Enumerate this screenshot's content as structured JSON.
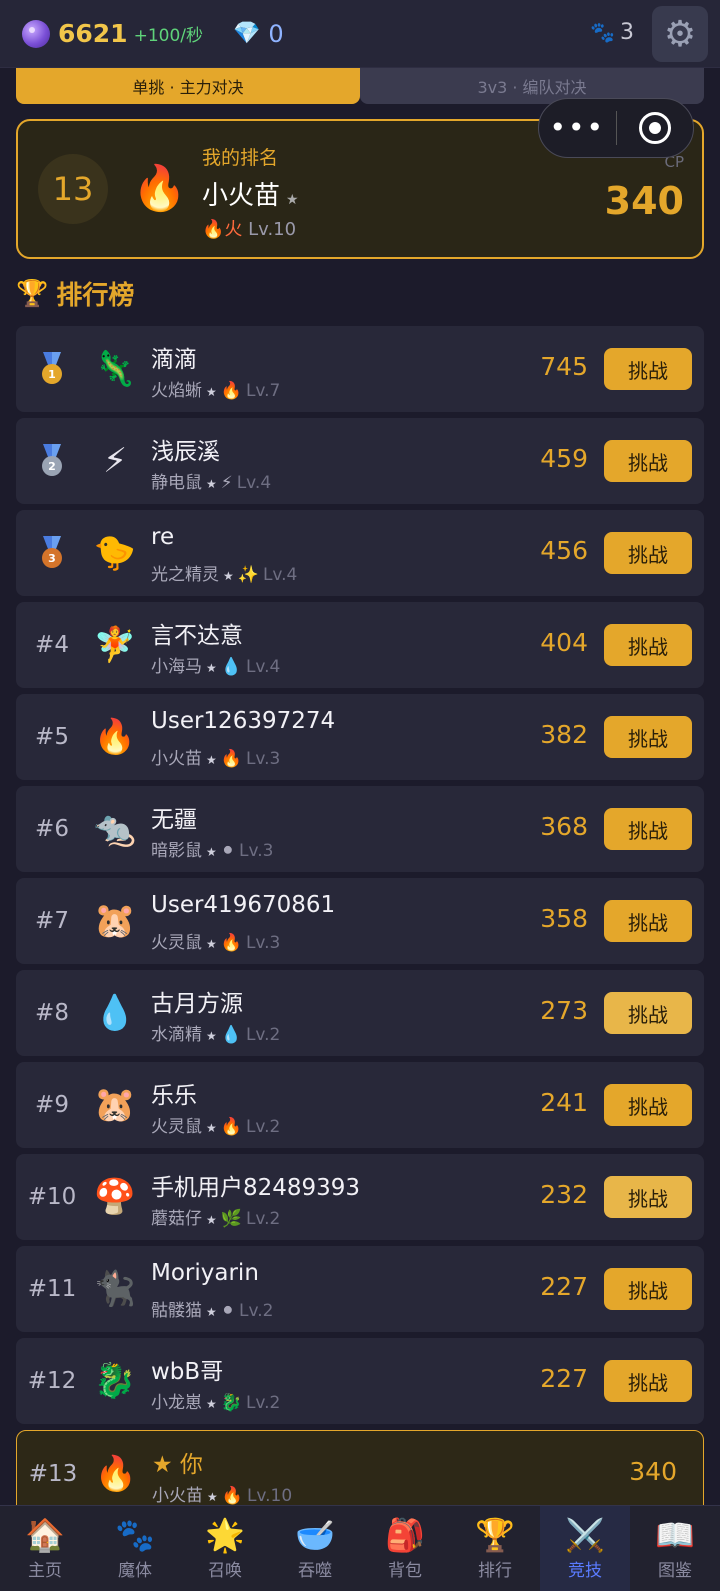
{
  "topbar": {
    "orb_icon": "purple-orb-icon",
    "coins": "6621",
    "rate": "+100/秒",
    "gems": "0",
    "paw_count": "3"
  },
  "tabs": [
    {
      "label": "单挑 · 主力对决",
      "active": true
    },
    {
      "label": "3v3 · 编队对决",
      "active": false
    }
  ],
  "capsule": {
    "more": "•••"
  },
  "my_rank": {
    "label": "我的排名",
    "rank": "13",
    "avatar": "🔥",
    "name": "小火苗",
    "star": "★",
    "element_icon": "🔥",
    "element": "火",
    "level": "Lv.10",
    "cp_label": "CP",
    "cp": "340"
  },
  "leaderboard": {
    "title": "排行榜",
    "challenge_label": "挑战",
    "rows": [
      {
        "rank": "1",
        "avatar": "🦎",
        "name": "滴滴",
        "species": "火焰蜥",
        "element": "🔥",
        "level": "Lv.7",
        "cp": "745"
      },
      {
        "rank": "2",
        "avatar": "⚡",
        "name": "  浅辰溪 ",
        "species": "静电鼠",
        "element": "⚡",
        "level": "Lv.4",
        "cp": "459"
      },
      {
        "rank": "3",
        "avatar": "🐤",
        "name": "re",
        "species": "光之精灵",
        "element": "✨",
        "level": "Lv.4",
        "cp": "456"
      },
      {
        "rank": "#4",
        "avatar": "🧚",
        "name": "言不达意",
        "species": "小海马",
        "element": "💧",
        "level": "Lv.4",
        "cp": "404"
      },
      {
        "rank": "#5",
        "avatar": "🔥",
        "name": "User126397274",
        "species": "小火苗",
        "element": "🔥",
        "level": "Lv.3",
        "cp": "382"
      },
      {
        "rank": "#6",
        "avatar": "🐀",
        "name": "无疆",
        "species": "暗影鼠",
        "element": "⚫",
        "level": "Lv.3",
        "cp": "368"
      },
      {
        "rank": "#7",
        "avatar": "🐹",
        "name": "User419670861",
        "species": "火灵鼠",
        "element": "🔥",
        "level": "Lv.3",
        "cp": "358"
      },
      {
        "rank": "#8",
        "avatar": "💧",
        "name": "古月方源",
        "species": "水滴精",
        "element": "💧",
        "level": "Lv.2",
        "cp": "273"
      },
      {
        "rank": "#9",
        "avatar": "🐹",
        "name": "乐乐",
        "species": "火灵鼠",
        "element": "🔥",
        "level": "Lv.2",
        "cp": "241"
      },
      {
        "rank": "#10",
        "avatar": "🍄",
        "name": "手机用户82489393",
        "species": "蘑菇仔",
        "element": "🌿",
        "level": "Lv.2",
        "cp": "232"
      },
      {
        "rank": "#11",
        "avatar": "🐈‍⬛",
        "name": "Moriyarin",
        "species": "骷髅猫",
        "element": "⚫",
        "level": "Lv.2",
        "cp": "227"
      },
      {
        "rank": "#12",
        "avatar": "🐉",
        "name": "wbB哥",
        "species": "小龙崽",
        "element": "🐉",
        "level": "Lv.2",
        "cp": "227"
      }
    ],
    "self_row": {
      "rank": "#13",
      "avatar": "🔥",
      "name": "★ 你",
      "species": "小火苗",
      "element": "🔥",
      "level": "Lv.10",
      "cp": "340"
    }
  },
  "bottom_nav": [
    {
      "label": "主页",
      "icon": "🏠"
    },
    {
      "label": "魔体",
      "icon": "🐾"
    },
    {
      "label": "召唤",
      "icon": "🌟"
    },
    {
      "label": "吞噬",
      "icon": "🥣"
    },
    {
      "label": "背包",
      "icon": "🎒"
    },
    {
      "label": "排行",
      "icon": "🏆"
    },
    {
      "label": "竞技",
      "icon": "⚔️",
      "active": true
    },
    {
      "label": "图鉴",
      "icon": "📖"
    }
  ]
}
